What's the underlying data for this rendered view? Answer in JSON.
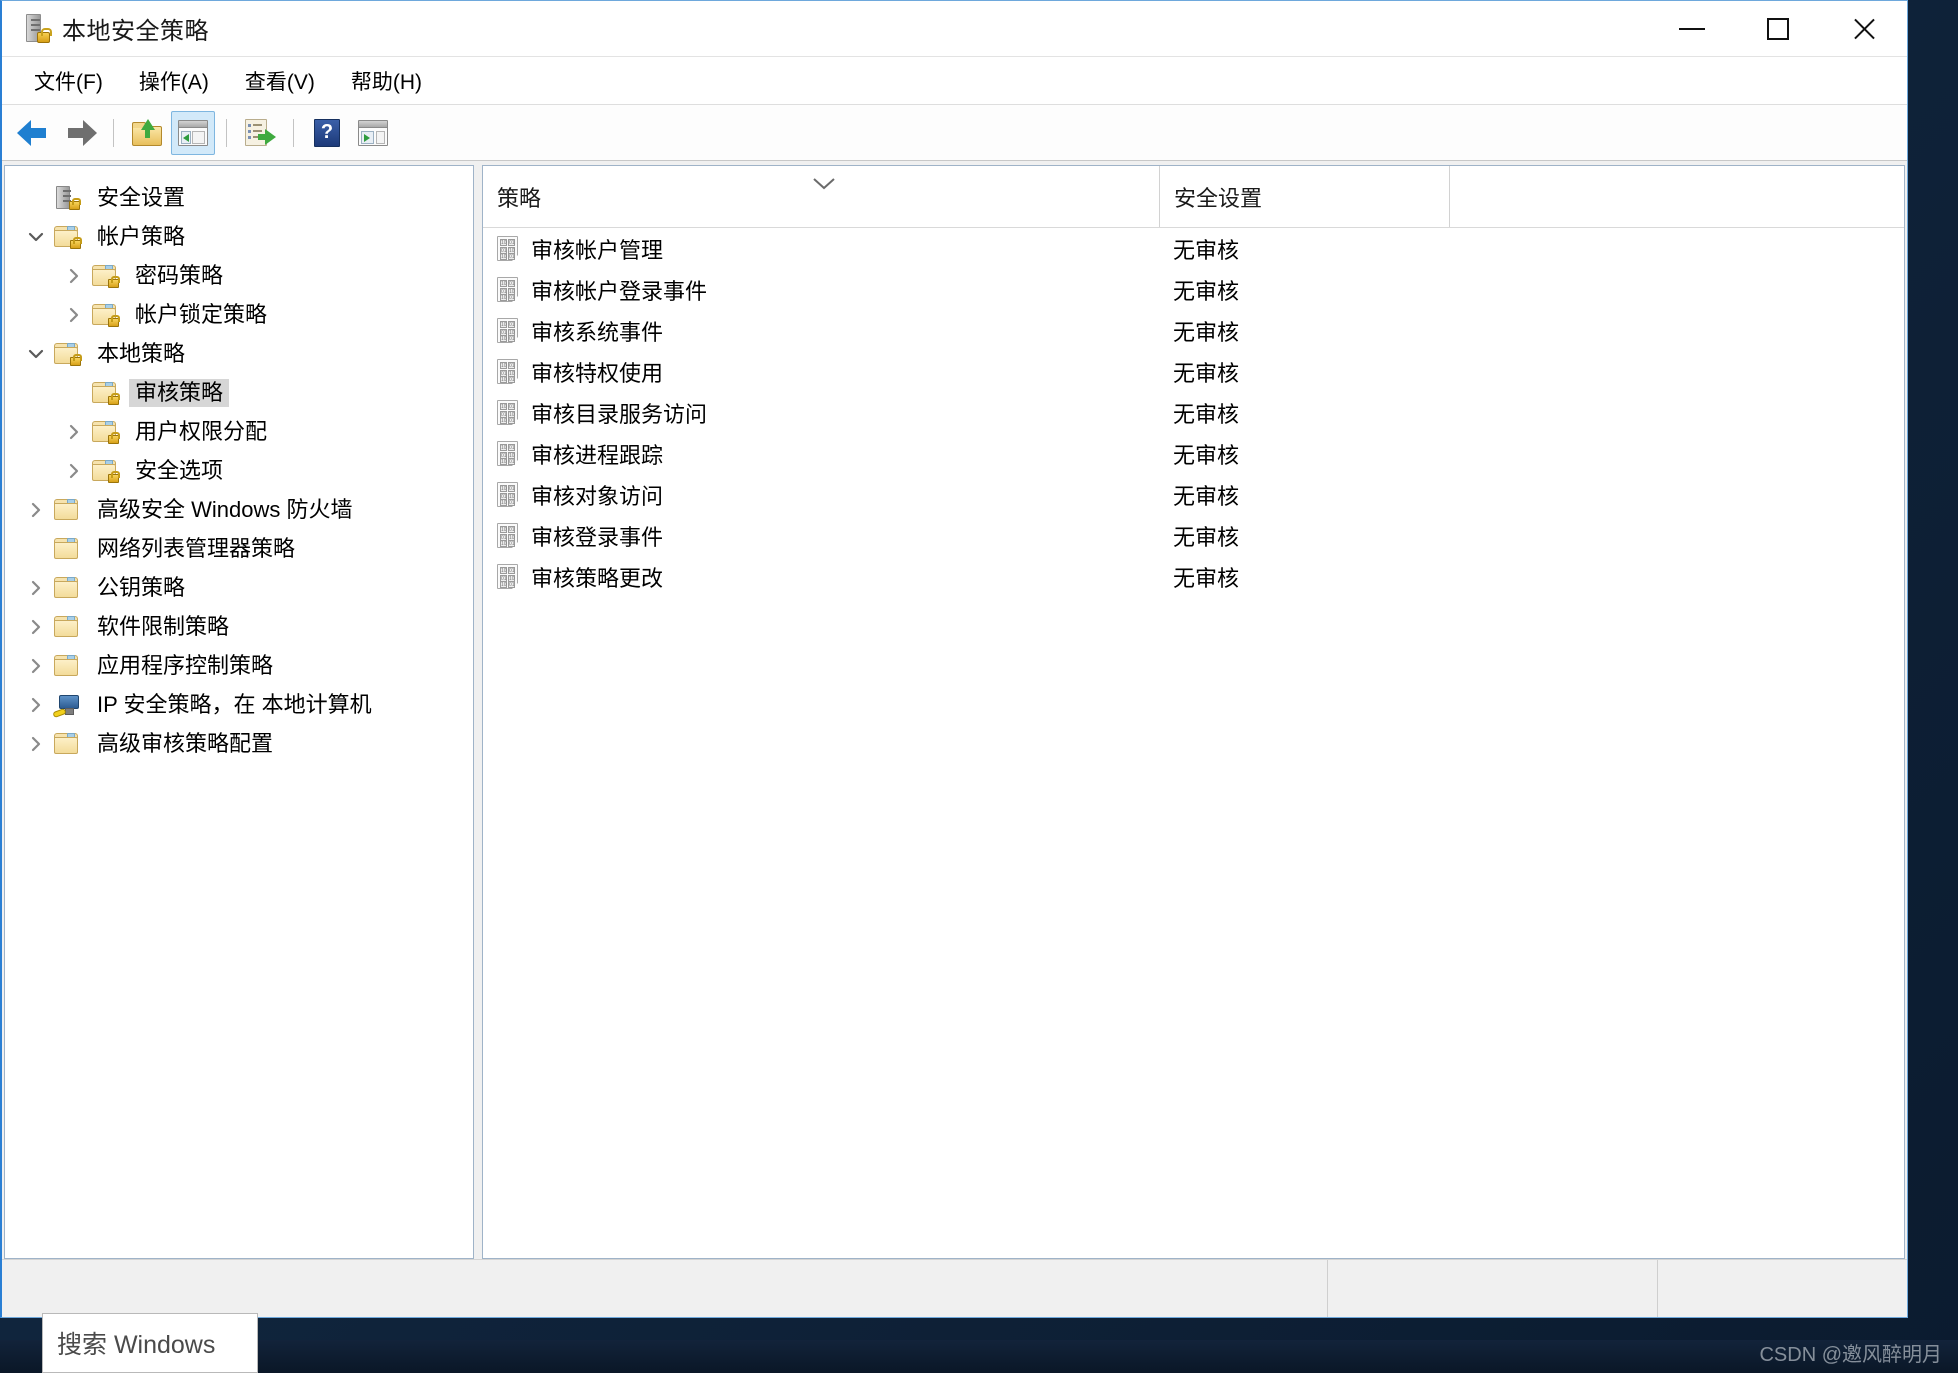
{
  "window": {
    "title": "本地安全策略",
    "title_icon": "server-lock-icon",
    "controls": {
      "minimize": "最小化",
      "maximize": "最大化",
      "close": "关闭"
    }
  },
  "menu": {
    "items": [
      {
        "label": "文件(F)",
        "name": "menu-file"
      },
      {
        "label": "操作(A)",
        "name": "menu-action"
      },
      {
        "label": "查看(V)",
        "name": "menu-view"
      },
      {
        "label": "帮助(H)",
        "name": "menu-help"
      }
    ]
  },
  "toolbar": {
    "buttons": [
      {
        "name": "back-button",
        "icon": "arrow-left-icon",
        "tooltip": "后退"
      },
      {
        "name": "forward-button",
        "icon": "arrow-right-icon",
        "tooltip": "前进"
      },
      {
        "name": "up-one-level-button",
        "icon": "folder-up-icon",
        "tooltip": "上移一级"
      },
      {
        "name": "show-hide-tree-button",
        "icon": "console-tree-icon",
        "tooltip": "显示/隐藏控制台树",
        "pressed": true
      },
      {
        "name": "export-list-button",
        "icon": "export-list-icon",
        "tooltip": "导出列表"
      },
      {
        "name": "help-button",
        "icon": "help-question-icon",
        "tooltip": "帮助"
      },
      {
        "name": "show-action-pane-button",
        "icon": "action-pane-icon",
        "tooltip": "显示/隐藏操作窗格"
      }
    ]
  },
  "tree": {
    "items": [
      {
        "label": "安全设置",
        "indent": 0,
        "chevron": "none",
        "icon": "server-lock-icon",
        "selected": false
      },
      {
        "label": "帐户策略",
        "indent": 0,
        "chevron": "expanded",
        "icon": "folder-lock-icon",
        "selected": false
      },
      {
        "label": "密码策略",
        "indent": 1,
        "chevron": "collapsed",
        "icon": "folder-lock-icon",
        "selected": false
      },
      {
        "label": "帐户锁定策略",
        "indent": 1,
        "chevron": "collapsed",
        "icon": "folder-lock-icon",
        "selected": false
      },
      {
        "label": "本地策略",
        "indent": 0,
        "chevron": "expanded",
        "icon": "folder-lock-icon",
        "selected": false
      },
      {
        "label": "审核策略",
        "indent": 1,
        "chevron": "none",
        "icon": "folder-lock-icon",
        "selected": true
      },
      {
        "label": "用户权限分配",
        "indent": 1,
        "chevron": "collapsed",
        "icon": "folder-lock-icon",
        "selected": false
      },
      {
        "label": "安全选项",
        "indent": 1,
        "chevron": "collapsed",
        "icon": "folder-lock-icon",
        "selected": false
      },
      {
        "label": "高级安全 Windows 防火墙",
        "indent": 0,
        "chevron": "collapsed",
        "icon": "folder-icon",
        "selected": false
      },
      {
        "label": "网络列表管理器策略",
        "indent": 0,
        "chevron": "none",
        "icon": "folder-icon",
        "selected": false
      },
      {
        "label": "公钥策略",
        "indent": 0,
        "chevron": "collapsed",
        "icon": "folder-icon",
        "selected": false
      },
      {
        "label": "软件限制策略",
        "indent": 0,
        "chevron": "collapsed",
        "icon": "folder-icon",
        "selected": false
      },
      {
        "label": "应用程序控制策略",
        "indent": 0,
        "chevron": "collapsed",
        "icon": "folder-icon",
        "selected": false
      },
      {
        "label": "IP 安全策略，在 本地计算机",
        "indent": 0,
        "chevron": "collapsed",
        "icon": "ipsec-icon",
        "selected": false
      },
      {
        "label": "高级审核策略配置",
        "indent": 0,
        "chevron": "collapsed",
        "icon": "folder-icon",
        "selected": false
      }
    ]
  },
  "list": {
    "columns": [
      {
        "label": "策略",
        "name": "column-policy",
        "sorted": true,
        "sort_direction": "descending"
      },
      {
        "label": "安全设置",
        "name": "column-setting",
        "sorted": false,
        "sort_direction": ""
      }
    ],
    "sort_glyph": "chevron-down",
    "rows": [
      {
        "policy": "审核帐户管理",
        "setting": "无审核",
        "icon": "policy-icon"
      },
      {
        "policy": "审核帐户登录事件",
        "setting": "无审核",
        "icon": "policy-icon"
      },
      {
        "policy": "审核系统事件",
        "setting": "无审核",
        "icon": "policy-icon"
      },
      {
        "policy": "审核特权使用",
        "setting": "无审核",
        "icon": "policy-icon"
      },
      {
        "policy": "审核目录服务访问",
        "setting": "无审核",
        "icon": "policy-icon"
      },
      {
        "policy": "审核进程跟踪",
        "setting": "无审核",
        "icon": "policy-icon"
      },
      {
        "policy": "审核对象访问",
        "setting": "无审核",
        "icon": "policy-icon"
      },
      {
        "policy": "审核登录事件",
        "setting": "无审核",
        "icon": "policy-icon"
      },
      {
        "policy": "审核策略更改",
        "setting": "无审核",
        "icon": "policy-icon"
      }
    ]
  },
  "taskbar": {
    "search_text": "搜索 Windows"
  },
  "watermark": {
    "text": "CSDN @邀风醉明月"
  },
  "colors": {
    "accent": "#2a7fd4",
    "selection": "#d6d6d6",
    "toolbar_pressed": "#d2e9f9",
    "desktop": "#0c1e33",
    "pane_border": "#9fb3c8"
  }
}
